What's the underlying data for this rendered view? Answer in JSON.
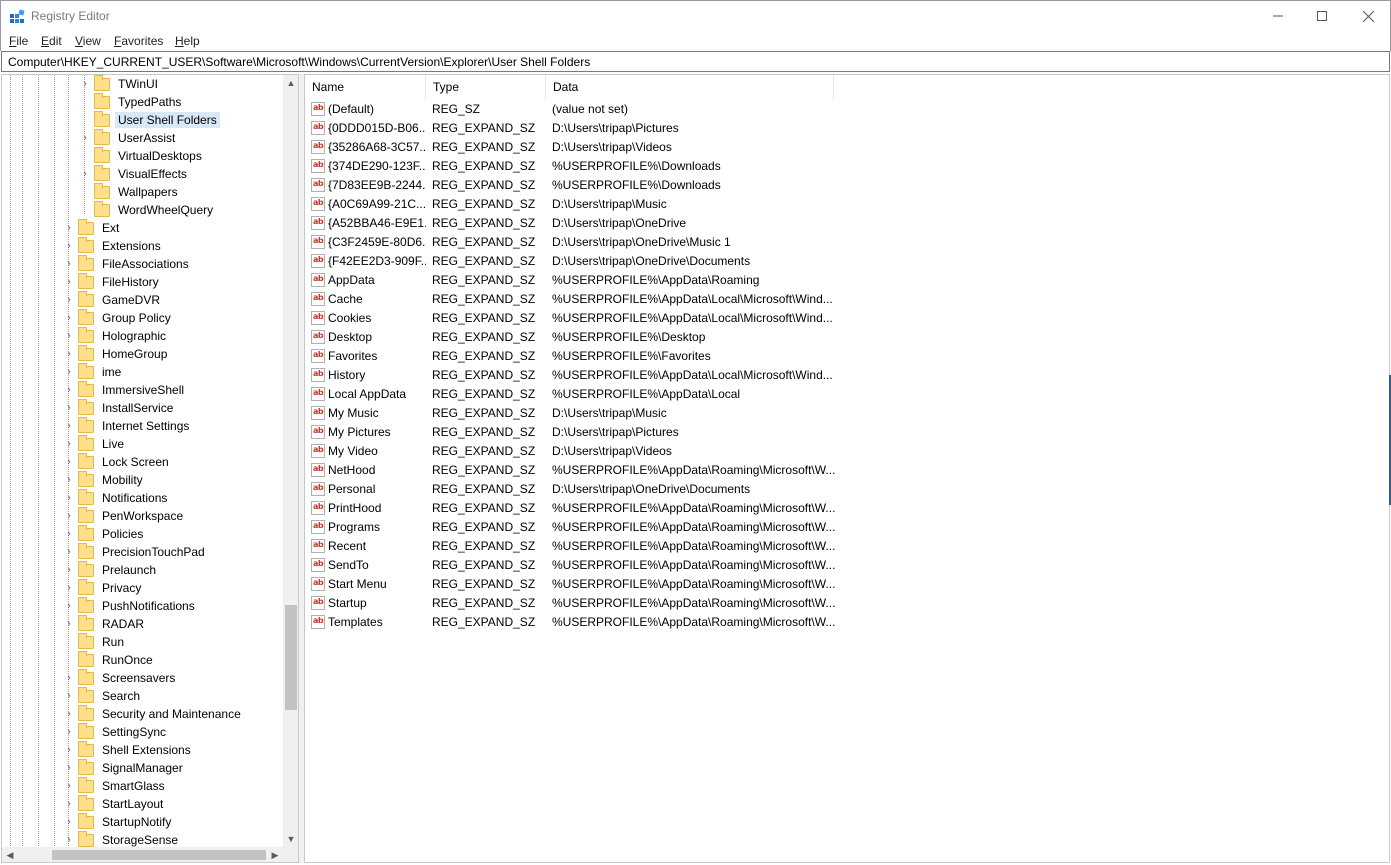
{
  "window": {
    "title": "Registry Editor",
    "controls": {
      "minimize": "—",
      "maximize": "☐",
      "close": "✕"
    }
  },
  "menu": [
    {
      "key": "F",
      "rest": "ile"
    },
    {
      "key": "E",
      "rest": "dit"
    },
    {
      "key": "V",
      "rest": "iew"
    },
    {
      "key": "F",
      "rest": "avorites"
    },
    {
      "key": "H",
      "rest": "elp"
    }
  ],
  "address": {
    "path": "Computer\\HKEY_CURRENT_USER\\Software\\Microsoft\\Windows\\CurrentVersion\\Explorer\\User Shell Folders"
  },
  "tree": {
    "items": [
      {
        "label": "TWinUI",
        "level": 2,
        "expandable": true
      },
      {
        "label": "TypedPaths",
        "level": 2,
        "expandable": false
      },
      {
        "label": "User Shell Folders",
        "level": 2,
        "expandable": false,
        "selected": true
      },
      {
        "label": "UserAssist",
        "level": 2,
        "expandable": true
      },
      {
        "label": "VirtualDesktops",
        "level": 2,
        "expandable": false
      },
      {
        "label": "VisualEffects",
        "level": 2,
        "expandable": true
      },
      {
        "label": "Wallpapers",
        "level": 2,
        "expandable": false
      },
      {
        "label": "WordWheelQuery",
        "level": 2,
        "expandable": false
      },
      {
        "label": "Ext",
        "level": 1,
        "expandable": true
      },
      {
        "label": "Extensions",
        "level": 1,
        "expandable": true
      },
      {
        "label": "FileAssociations",
        "level": 1,
        "expandable": true
      },
      {
        "label": "FileHistory",
        "level": 1,
        "expandable": true
      },
      {
        "label": "GameDVR",
        "level": 1,
        "expandable": true
      },
      {
        "label": "Group Policy",
        "level": 1,
        "expandable": true
      },
      {
        "label": "Holographic",
        "level": 1,
        "expandable": true
      },
      {
        "label": "HomeGroup",
        "level": 1,
        "expandable": true
      },
      {
        "label": "ime",
        "level": 1,
        "expandable": true
      },
      {
        "label": "ImmersiveShell",
        "level": 1,
        "expandable": true
      },
      {
        "label": "InstallService",
        "level": 1,
        "expandable": true
      },
      {
        "label": "Internet Settings",
        "level": 1,
        "expandable": true
      },
      {
        "label": "Live",
        "level": 1,
        "expandable": true
      },
      {
        "label": "Lock Screen",
        "level": 1,
        "expandable": true
      },
      {
        "label": "Mobility",
        "level": 1,
        "expandable": true
      },
      {
        "label": "Notifications",
        "level": 1,
        "expandable": true
      },
      {
        "label": "PenWorkspace",
        "level": 1,
        "expandable": true
      },
      {
        "label": "Policies",
        "level": 1,
        "expandable": true
      },
      {
        "label": "PrecisionTouchPad",
        "level": 1,
        "expandable": true
      },
      {
        "label": "Prelaunch",
        "level": 1,
        "expandable": true
      },
      {
        "label": "Privacy",
        "level": 1,
        "expandable": true
      },
      {
        "label": "PushNotifications",
        "level": 1,
        "expandable": true
      },
      {
        "label": "RADAR",
        "level": 1,
        "expandable": true
      },
      {
        "label": "Run",
        "level": 1,
        "expandable": false
      },
      {
        "label": "RunOnce",
        "level": 1,
        "expandable": false
      },
      {
        "label": "Screensavers",
        "level": 1,
        "expandable": true
      },
      {
        "label": "Search",
        "level": 1,
        "expandable": true
      },
      {
        "label": "Security and Maintenance",
        "level": 1,
        "expandable": true
      },
      {
        "label": "SettingSync",
        "level": 1,
        "expandable": true
      },
      {
        "label": "Shell Extensions",
        "level": 1,
        "expandable": true
      },
      {
        "label": "SignalManager",
        "level": 1,
        "expandable": true
      },
      {
        "label": "SmartGlass",
        "level": 1,
        "expandable": true
      },
      {
        "label": "StartLayout",
        "level": 1,
        "expandable": true
      },
      {
        "label": "StartupNotify",
        "level": 1,
        "expandable": true
      },
      {
        "label": "StorageSense",
        "level": 1,
        "expandable": true
      }
    ]
  },
  "list": {
    "columns": [
      "Name",
      "Type",
      "Data"
    ],
    "rows": [
      {
        "name": "(Default)",
        "type": "REG_SZ",
        "data": "(value not set)"
      },
      {
        "name": "{0DDD015D-B06...",
        "type": "REG_EXPAND_SZ",
        "data": "D:\\Users\\tripap\\Pictures"
      },
      {
        "name": "{35286A68-3C57...",
        "type": "REG_EXPAND_SZ",
        "data": "D:\\Users\\tripap\\Videos"
      },
      {
        "name": "{374DE290-123F...",
        "type": "REG_EXPAND_SZ",
        "data": "%USERPROFILE%\\Downloads"
      },
      {
        "name": "{7D83EE9B-2244...",
        "type": "REG_EXPAND_SZ",
        "data": "%USERPROFILE%\\Downloads"
      },
      {
        "name": "{A0C69A99-21C...",
        "type": "REG_EXPAND_SZ",
        "data": "D:\\Users\\tripap\\Music"
      },
      {
        "name": "{A52BBA46-E9E1...",
        "type": "REG_EXPAND_SZ",
        "data": "D:\\Users\\tripap\\OneDrive"
      },
      {
        "name": "{C3F2459E-80D6...",
        "type": "REG_EXPAND_SZ",
        "data": "D:\\Users\\tripap\\OneDrive\\Music 1"
      },
      {
        "name": "{F42EE2D3-909F...",
        "type": "REG_EXPAND_SZ",
        "data": "D:\\Users\\tripap\\OneDrive\\Documents"
      },
      {
        "name": "AppData",
        "type": "REG_EXPAND_SZ",
        "data": "%USERPROFILE%\\AppData\\Roaming"
      },
      {
        "name": "Cache",
        "type": "REG_EXPAND_SZ",
        "data": "%USERPROFILE%\\AppData\\Local\\Microsoft\\Wind..."
      },
      {
        "name": "Cookies",
        "type": "REG_EXPAND_SZ",
        "data": "%USERPROFILE%\\AppData\\Local\\Microsoft\\Wind..."
      },
      {
        "name": "Desktop",
        "type": "REG_EXPAND_SZ",
        "data": "%USERPROFILE%\\Desktop"
      },
      {
        "name": "Favorites",
        "type": "REG_EXPAND_SZ",
        "data": "%USERPROFILE%\\Favorites"
      },
      {
        "name": "History",
        "type": "REG_EXPAND_SZ",
        "data": "%USERPROFILE%\\AppData\\Local\\Microsoft\\Wind..."
      },
      {
        "name": "Local AppData",
        "type": "REG_EXPAND_SZ",
        "data": "%USERPROFILE%\\AppData\\Local"
      },
      {
        "name": "My Music",
        "type": "REG_EXPAND_SZ",
        "data": "D:\\Users\\tripap\\Music"
      },
      {
        "name": "My Pictures",
        "type": "REG_EXPAND_SZ",
        "data": "D:\\Users\\tripap\\Pictures"
      },
      {
        "name": "My Video",
        "type": "REG_EXPAND_SZ",
        "data": "D:\\Users\\tripap\\Videos"
      },
      {
        "name": "NetHood",
        "type": "REG_EXPAND_SZ",
        "data": "%USERPROFILE%\\AppData\\Roaming\\Microsoft\\W..."
      },
      {
        "name": "Personal",
        "type": "REG_EXPAND_SZ",
        "data": "D:\\Users\\tripap\\OneDrive\\Documents"
      },
      {
        "name": "PrintHood",
        "type": "REG_EXPAND_SZ",
        "data": "%USERPROFILE%\\AppData\\Roaming\\Microsoft\\W..."
      },
      {
        "name": "Programs",
        "type": "REG_EXPAND_SZ",
        "data": "%USERPROFILE%\\AppData\\Roaming\\Microsoft\\W..."
      },
      {
        "name": "Recent",
        "type": "REG_EXPAND_SZ",
        "data": "%USERPROFILE%\\AppData\\Roaming\\Microsoft\\W..."
      },
      {
        "name": "SendTo",
        "type": "REG_EXPAND_SZ",
        "data": "%USERPROFILE%\\AppData\\Roaming\\Microsoft\\W..."
      },
      {
        "name": "Start Menu",
        "type": "REG_EXPAND_SZ",
        "data": "%USERPROFILE%\\AppData\\Roaming\\Microsoft\\W..."
      },
      {
        "name": "Startup",
        "type": "REG_EXPAND_SZ",
        "data": "%USERPROFILE%\\AppData\\Roaming\\Microsoft\\W..."
      },
      {
        "name": "Templates",
        "type": "REG_EXPAND_SZ",
        "data": "%USERPROFILE%\\AppData\\Roaming\\Microsoft\\W..."
      }
    ]
  },
  "icons": {
    "string_value": "ab",
    "string_value_color": "#c0392b",
    "folder_color": "#ffe08a",
    "selection_color": "#d9e8f7"
  }
}
